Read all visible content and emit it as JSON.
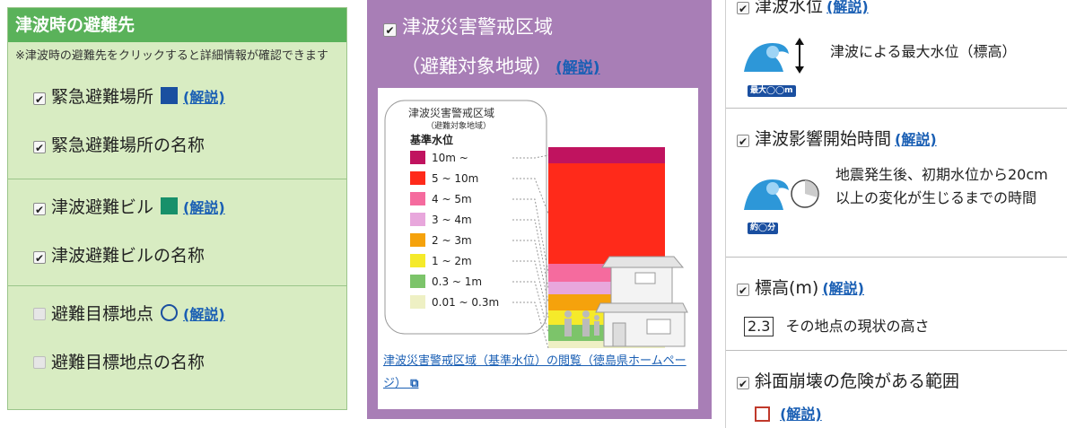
{
  "evac": {
    "title": "津波時の避難先",
    "note": "※津波時の避難先をクリックすると詳細情報が確認できます",
    "items": [
      {
        "label": "緊急避難場所",
        "checked": true,
        "marker": "square",
        "color": "#1a4fa0",
        "link": "(解説)"
      },
      {
        "label": "緊急避難場所の名称",
        "checked": true
      },
      {
        "label": "津波避難ビル",
        "checked": true,
        "marker": "square",
        "color": "#17906a",
        "link": "(解説)"
      },
      {
        "label": "津波避難ビルの名称",
        "checked": true
      },
      {
        "label": "避難目標地点",
        "checked": false,
        "marker": "circle",
        "color": "#1a4fa0",
        "link": "(解説)"
      },
      {
        "label": "避難目標地点の名称",
        "checked": false
      }
    ]
  },
  "warning_zone": {
    "title_line1": "津波災害警戒区域",
    "title_line2": "（避難対象地域）",
    "link": "(解説)",
    "checked": true,
    "legend_title": "津波災害警戒区域",
    "legend_subtitle": "（避難対象地域）",
    "legend_heading": "基準水位",
    "levels": [
      {
        "label": "10m ~",
        "color": "#c0135f"
      },
      {
        "label": "5 ~ 10m",
        "color": "#ff2a1a"
      },
      {
        "label": "4 ~ 5m",
        "color": "#f56b9e"
      },
      {
        "label": "3 ~ 4m",
        "color": "#e8a7dc"
      },
      {
        "label": "2 ~ 3m",
        "color": "#f5a20c"
      },
      {
        "label": "1 ~ 2m",
        "color": "#f5ea2a"
      },
      {
        "label": "0.3 ~ 1m",
        "color": "#7cc46a"
      },
      {
        "label": "0.01 ~ 0.3m",
        "color": "#eef0c4"
      }
    ],
    "footer_link": "津波災害警戒区域（基準水位）の閲覧（徳島県ホームページ）"
  },
  "right": {
    "max_level": {
      "label": "津波水位",
      "link": "(解説)",
      "desc": "津波による最大水位（標高）",
      "tag": "最大◯◯m"
    },
    "impact_time": {
      "label": "津波影響開始時間",
      "link": "(解説)",
      "desc": "地震発生後、初期水位から20cm以上の変化が生じるまでの時間",
      "tag": "約◯分"
    },
    "elevation": {
      "label": "標高(m)",
      "link": "(解説)",
      "sample_value": "2.3",
      "desc": "その地点の現状の高さ"
    },
    "slope": {
      "label": "斜面崩壊の危険がある範囲",
      "link": "(解説)",
      "color": "#c0392b"
    }
  }
}
